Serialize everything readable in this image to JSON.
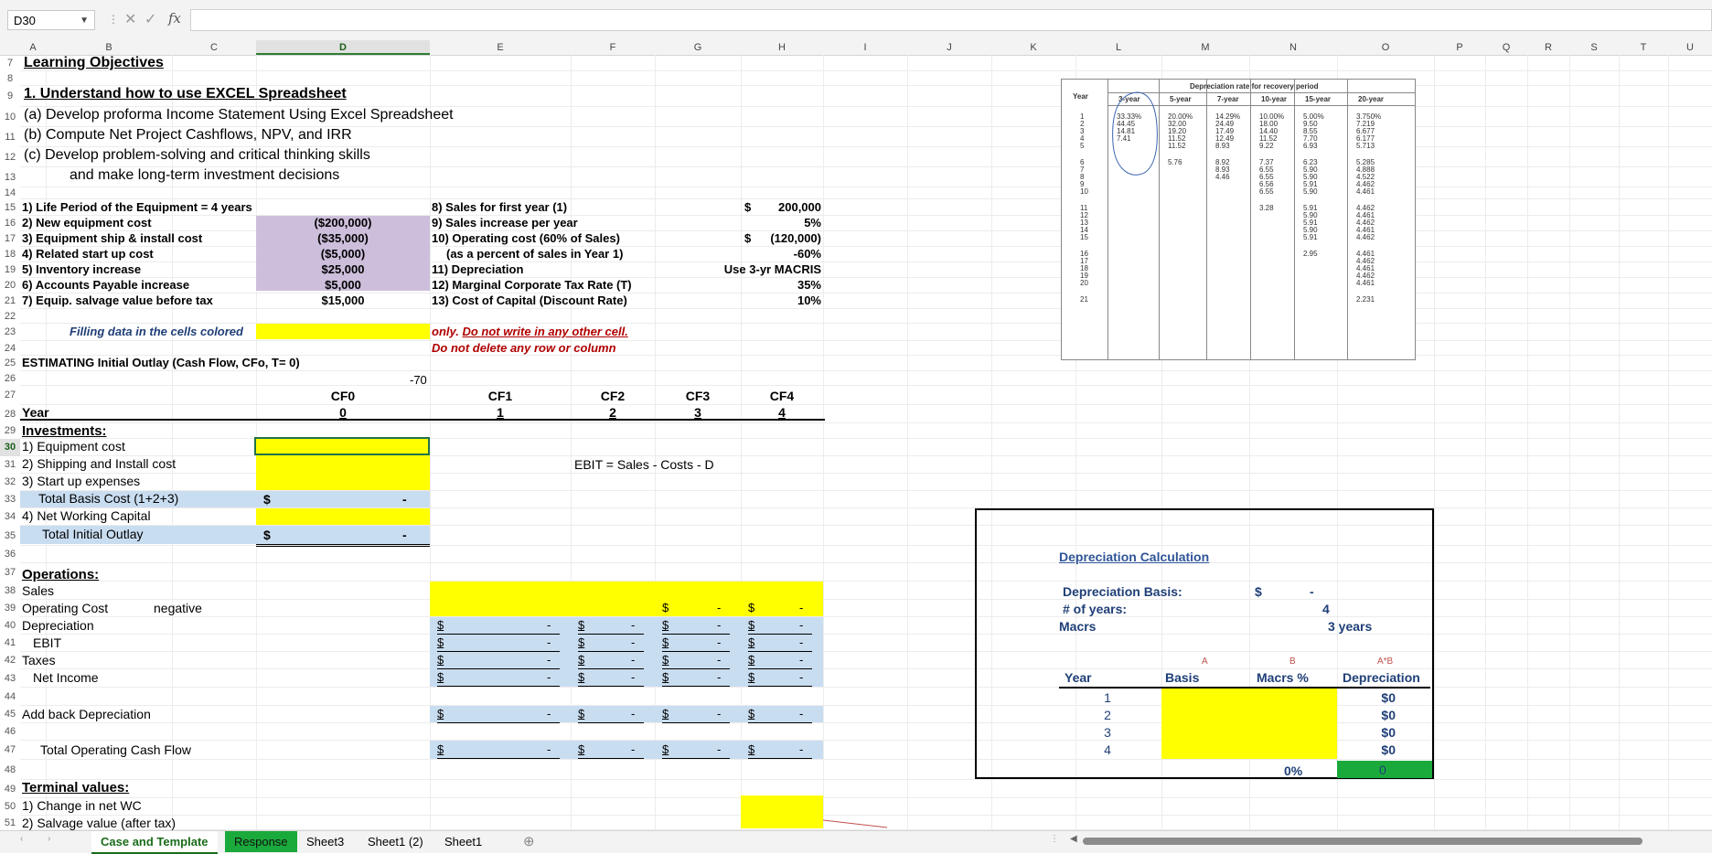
{
  "formula_bar": {
    "cell_ref": "D30",
    "fx": "fx",
    "cancel": "✕",
    "enter": "✓",
    "value": ""
  },
  "columns": [
    "A",
    "B",
    "C",
    "D",
    "E",
    "F",
    "G",
    "H",
    "I",
    "J",
    "K",
    "L",
    "M",
    "N",
    "O",
    "P",
    "Q",
    "R",
    "S",
    "T",
    "U"
  ],
  "rows": [
    "7",
    "8",
    "9",
    "10",
    "11",
    "12",
    "13",
    "14",
    "15",
    "16",
    "17",
    "18",
    "19",
    "20",
    "21",
    "22",
    "23",
    "24",
    "25",
    "26",
    "27",
    "28",
    "29",
    "30",
    "31",
    "32",
    "33",
    "34",
    "35",
    "36",
    "37",
    "38",
    "39",
    "40",
    "41",
    "42",
    "43",
    "44",
    "45",
    "46",
    "47",
    "48",
    "49",
    "50",
    "51"
  ],
  "sheet": {
    "title": "Learning Objectives",
    "obj1": "1. Understand how to use EXCEL Spreadsheet",
    "obj_a": "(a)  Develop proforma Income Statement Using Excel Spreadsheet",
    "obj_b": "(b)  Compute  Net Project Cashflows, NPV,  and IRR",
    "obj_c": "(c)  Develop problem-solving and  critical thinking skills",
    "obj_c2": "and make long-term investment decisions",
    "inputs_left": [
      {
        "label": "1) Life Period of the Equipment = 4 years",
        "value": ""
      },
      {
        "label": "2) New equipment cost",
        "value": "($200,000)"
      },
      {
        "label": "3) Equipment ship & install cost",
        "value": "($35,000)"
      },
      {
        "label": "4) Related start up cost",
        "value": "($5,000)"
      },
      {
        "label": "5) Inventory increase",
        "value": "$25,000"
      },
      {
        "label": "6) Accounts Payable increase",
        "value": "$5,000"
      },
      {
        "label": "7) Equip. salvage value before tax",
        "value": "$15,000"
      }
    ],
    "inputs_right": [
      {
        "label": "8) Sales for first year (1)",
        "cur": "$",
        "value": "200,000"
      },
      {
        "label": "9) Sales increase per year",
        "cur": "",
        "value": "5%"
      },
      {
        "label": "10) Operating cost (60% of Sales)",
        "cur": "$",
        "value": "(120,000)"
      },
      {
        "label": "(as a percent of sales in Year 1)",
        "cur": "",
        "value": "-60%"
      },
      {
        "label": "11) Depreciation",
        "cur": "",
        "value": "Use 3-yr MACRIS"
      },
      {
        "label": "12) Marginal Corporate Tax Rate (T)",
        "cur": "",
        "value": "35%"
      },
      {
        "label": "13) Cost of Capital (Discount Rate)",
        "cur": "",
        "value": "10%"
      }
    ],
    "filling_note": "Filling data in the cells colored",
    "only_a": "only.",
    "only_b": "Do not write in any other cell.",
    "do_not_delete": "Do not delete any row or column",
    "estimating": "ESTIMATING  Initial Outlay (Cash Flow, CFo, T= 0)",
    "minus70": "-70",
    "cf_headers": [
      "CF0",
      "CF1",
      "CF2",
      "CF3",
      "CF4"
    ],
    "year_label": "Year",
    "years": [
      "0",
      "1",
      "2",
      "3",
      "4"
    ],
    "investments": "Investments:",
    "inv_items": [
      "1) Equipment cost",
      "2) Shipping and Install cost",
      "3) Start up expenses",
      "Total Basis Cost (1+2+3)",
      "4)  Net Working Capital",
      "Total Initial Outlay"
    ],
    "ebit_note": "EBIT = Sales - Costs - D",
    "operations": "Operations:",
    "op_items": [
      "Sales",
      "Operating Cost",
      "Depreciation",
      "EBIT",
      "Taxes",
      "Net Income"
    ],
    "negative": "negative",
    "add_back": "Add back  Depreciation",
    "total_ocf": "Total Operating Cash Flow",
    "terminal": "Terminal values:",
    "term_items": [
      "1) Change in net WC",
      "2) Salvage value (after tax)"
    ],
    "cur": "$",
    "dash": "-"
  },
  "dep_calc": {
    "title": "Depreciation Calculation",
    "basis_label": "Depreciation Basis:",
    "basis_cur": "$",
    "basis_value": "-",
    "years_label": "# of years:",
    "years_value": "4",
    "macrs_label": "Macrs",
    "macrs_value": "3 years",
    "col_letters": [
      "A",
      "B",
      "A*B"
    ],
    "headers": [
      "Year",
      "Basis",
      "Macrs %",
      "Depreciation"
    ],
    "rows": [
      {
        "year": "1",
        "dep": "$0"
      },
      {
        "year": "2",
        "dep": "$0"
      },
      {
        "year": "3",
        "dep": "$0"
      },
      {
        "year": "4",
        "dep": "$0"
      }
    ],
    "total_pct": "0%",
    "total_dep": "0"
  },
  "macrs_table": {
    "title": "Depreciation rate for recovery period",
    "year_header": "Year",
    "periods": [
      "3-year",
      "5-year",
      "7-year",
      "10-year",
      "15-year",
      "20-year"
    ],
    "years": [
      "1",
      "2",
      "3",
      "4",
      "5",
      "6",
      "7",
      "8",
      "9",
      "10",
      "11",
      "12",
      "13",
      "14",
      "15",
      "16",
      "17",
      "18",
      "19",
      "20",
      "21"
    ],
    "cols": [
      [
        "33.33%",
        "44.45",
        "14.81",
        "7.41"
      ],
      [
        "20.00%",
        "32.00",
        "19.20",
        "11.52",
        "11.52",
        "5.76"
      ],
      [
        "14.29%",
        "24.49",
        "17.49",
        "12.49",
        "8.93",
        "8.92",
        "8.93",
        "4.46"
      ],
      [
        "10.00%",
        "18.00",
        "14.40",
        "11.52",
        "9.22",
        "7.37",
        "6.55",
        "6.55",
        "6.56",
        "6.55",
        "3.28"
      ],
      [
        "5.00%",
        "9.50",
        "8.55",
        "7.70",
        "6.93",
        "6.23",
        "5.90",
        "5.90",
        "5.91",
        "5.90",
        "5.91",
        "5.90",
        "5.91",
        "5.90",
        "5.91",
        "2.95"
      ],
      [
        "3.750%",
        "7.219",
        "6.677",
        "6.177",
        "5.713",
        "5.285",
        "4.888",
        "4.522",
        "4.462",
        "4.461",
        "4.462",
        "4.461",
        "4.462",
        "4.461",
        "4.462",
        "4.461",
        "4.462",
        "4.461",
        "4.462",
        "4.461",
        "2.231"
      ]
    ]
  },
  "tabs": [
    "Case and Template",
    "Response",
    "Sheet3",
    "Sheet1 (2)",
    "Sheet1"
  ],
  "colors": {
    "yellow": "#ffff00",
    "lavender": "#cdbfdc",
    "blue": "#c9ddf1",
    "green": "#1aaa3c",
    "tab_active": "#1a6b1a"
  }
}
